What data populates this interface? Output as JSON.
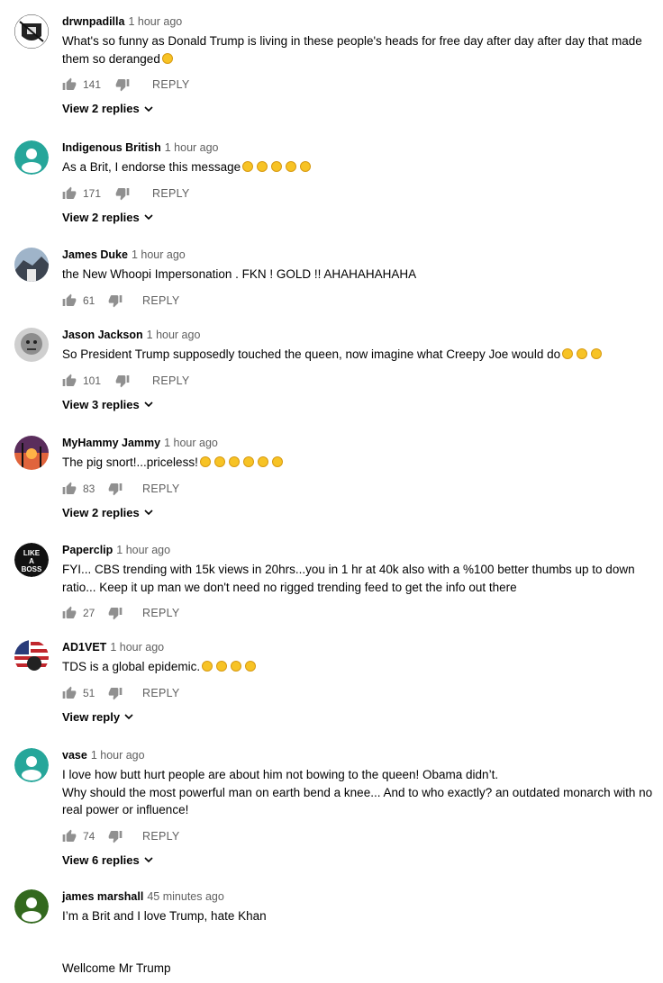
{
  "comments": [
    {
      "author": "drwnpadilla",
      "time": "1 hour ago",
      "text": [
        "What's so funny as Donald Trump is living in these people's heads for free day after day after day that made them so deranged"
      ],
      "emoji_count": 1,
      "likes": "141",
      "reply_label": "REPLY",
      "replies_label": "View 2 replies",
      "avatar": {
        "type": "raider",
        "bg": "#ffffff"
      }
    },
    {
      "author": "Indigenous British",
      "time": "1 hour ago",
      "text": [
        "As a Brit, I endorse this message"
      ],
      "emoji_count": 5,
      "likes": "171",
      "reply_label": "REPLY",
      "replies_label": "View 2 replies",
      "avatar": {
        "type": "default",
        "bg": "#26a69a"
      }
    },
    {
      "author": "James Duke",
      "time": "1 hour ago",
      "text": [
        "the New Whoopi Impersonation . FKN ! GOLD !!  AHAHAHAHAHA"
      ],
      "emoji_count": 0,
      "likes": "61",
      "reply_label": "REPLY",
      "replies_label": "",
      "avatar": {
        "type": "photo",
        "bg": "#8fa3b8"
      }
    },
    {
      "author": "Jason Jackson",
      "time": "1 hour ago",
      "text": [
        "So President Trump supposedly touched the queen, now imagine what Creepy Joe would do"
      ],
      "emoji_count": 3,
      "likes": "101",
      "reply_label": "REPLY",
      "replies_label": "View 3 replies",
      "avatar": {
        "type": "photo",
        "bg": "#c9c9c9"
      }
    },
    {
      "author": "MyHammy Jammy",
      "time": "1 hour ago",
      "text": [
        "The pig snort!...priceless!"
      ],
      "emoji_count": 6,
      "likes": "83",
      "reply_label": "REPLY",
      "replies_label": "View 2 replies",
      "avatar": {
        "type": "sunset",
        "bg": "#d2523a"
      }
    },
    {
      "author": "Paperclip",
      "time": "1 hour ago",
      "text": [
        "FYI... CBS trending with 15k views in 20hrs...you in 1 hr at 40k also with a %100 better thumbs up to down ratio... Keep it up man we don't need no rigged trending feed to get the info out there"
      ],
      "emoji_count": 0,
      "likes": "27",
      "reply_label": "REPLY",
      "replies_label": "",
      "avatar": {
        "type": "boss",
        "bg": "#111111",
        "label": "LIKE A BOSS"
      }
    },
    {
      "author": "AD1VET",
      "time": "1 hour ago",
      "text": [
        "TDS is a global epidemic."
      ],
      "emoji_count": 4,
      "likes": "51",
      "reply_label": "REPLY",
      "replies_label": "View reply",
      "avatar": {
        "type": "flag",
        "bg": "#2a3c7a"
      }
    },
    {
      "author": "vase",
      "time": "1 hour ago",
      "text": [
        "I love how butt hurt people are about him not bowing to the queen! Obama didn’t.",
        "Why should the most powerful man on earth bend a knee... And to who exactly? an outdated monarch with no real power or influence!"
      ],
      "emoji_count": 0,
      "likes": "74",
      "reply_label": "REPLY",
      "replies_label": "View 6 replies",
      "avatar": {
        "type": "default",
        "bg": "#26a69a"
      }
    },
    {
      "author": "james marshall",
      "time": "45 minutes ago",
      "text": [
        "I’m a Brit and I love Trump, hate Khan",
        "",
        "Wellcome Mr Trump"
      ],
      "emoji_count": 0,
      "likes": "",
      "reply_label": "",
      "replies_label": "",
      "avatar": {
        "type": "default",
        "bg": "#33691e"
      }
    }
  ]
}
